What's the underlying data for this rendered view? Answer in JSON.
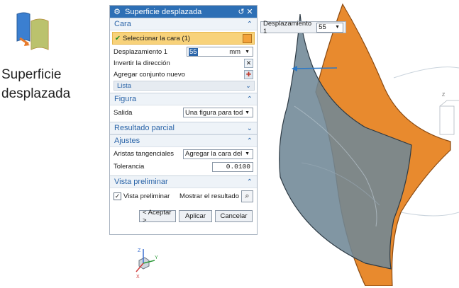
{
  "command": {
    "title": "Superficie desplazada"
  },
  "dialog": {
    "title": "Superficie desplazada",
    "cara": {
      "header": "Cara",
      "select_face": "Seleccionar la cara (1)",
      "offset_label": "Desplazamiento 1",
      "offset_value": "55",
      "offset_unit": "mm",
      "reverse_label": "Invertir la dirección",
      "add_set_label": "Agregar conjunto nuevo",
      "list_label": "Lista"
    },
    "figura": {
      "header": "Figura",
      "output_label": "Salida",
      "output_value": "Una figura para toda"
    },
    "resultado": {
      "header": "Resultado parcial"
    },
    "ajustes": {
      "header": "Ajustes",
      "tangent_label": "Aristas tangenciales",
      "tangent_value": "Agregar la cara del e",
      "tolerance_label": "Tolerancia",
      "tolerance_value": "0.0100"
    },
    "vista": {
      "header": "Vista preliminar",
      "preview_label": "Vista preliminar",
      "show_result_label": "Mostrar el resultado"
    },
    "buttons": {
      "ok": "< Aceptar >",
      "apply": "Aplicar",
      "cancel": "Cancelar"
    }
  },
  "float_input": {
    "label": "Desplazamiento 1",
    "value": "55"
  },
  "colors": {
    "title_bar": "#2d6fb5",
    "accent": "#2a64a8",
    "selection": "#f8d27a",
    "surface_orange": "#e88a2e",
    "surface_gray": "#6f8796"
  }
}
